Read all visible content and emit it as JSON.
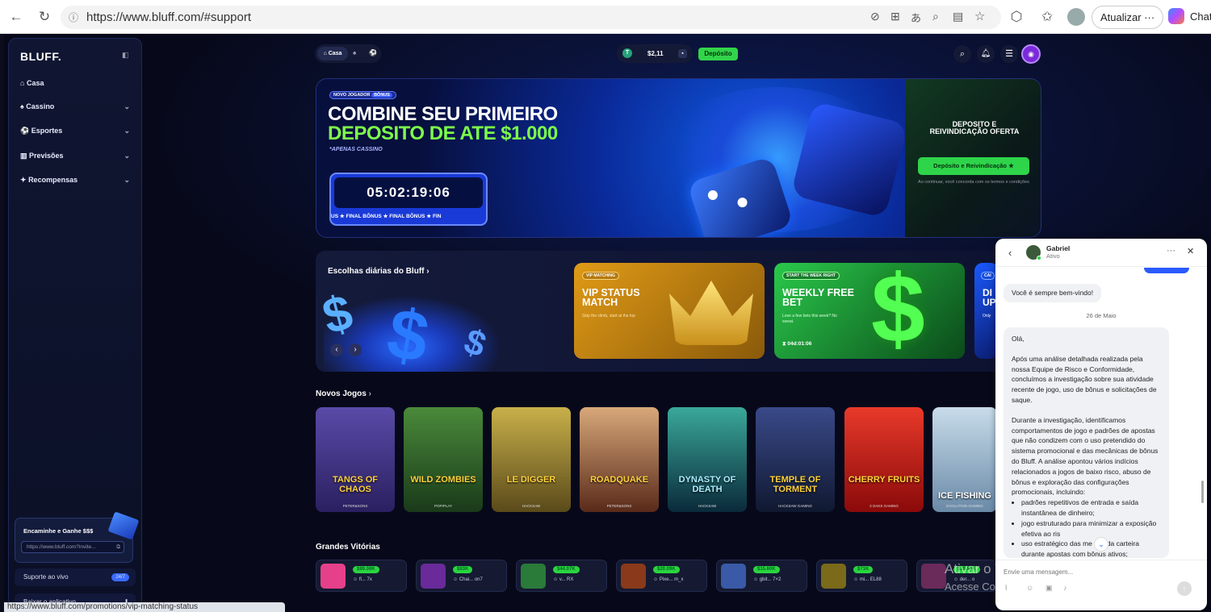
{
  "browser": {
    "url": "https://www.bluff.com/#support",
    "update_label": "Atualizar",
    "more": "···",
    "chat_label": "Chat",
    "status_url": "https://www.bluff.com/promotions/vip-matching-status"
  },
  "sidebar": {
    "logo": "BLUFF.",
    "items": [
      {
        "label": "Casa"
      },
      {
        "label": "Cassino"
      },
      {
        "label": "Esportes"
      },
      {
        "label": "Previsões"
      },
      {
        "label": "Recompensas"
      }
    ],
    "referral": {
      "title": "Encaminhe e Ganhe $$$",
      "link": "https://www.bluff.com?invite..."
    },
    "support": {
      "label": "Suporte ao vivo",
      "badge": "24/7"
    },
    "download": {
      "label": "Baixar o aplicativo"
    }
  },
  "topbar": {
    "home_tab": "Casa",
    "balance": "$2,11",
    "deposit": "Depósito"
  },
  "banner": {
    "tag1": "NOVO JOGADOR",
    "tag2": "BÔNUS",
    "headline1": "COMBINE SEU PRIMEIRO",
    "headline2": "DEPOSITO DE ATE $1.000",
    "sub": "*APENAS CASSINO",
    "timer": "05:02:19:06",
    "ticker": "US ★ FINAL BÔNUS ★ FINAL BÔNUS ★ FIN",
    "offer_title": "DEPOSITO E REIVINDICAÇÃO OFERTA",
    "offer_button": "Depósito e Reivindicação ★",
    "terms": "Ao continuar, você concorda com os termos e condições"
  },
  "daily": {
    "title": "Escolhas diárias do Bluff",
    "arrow": "›",
    "cards": [
      {
        "tag1": "VIP",
        "tag2": "MATCHING",
        "title": "VIP STATUS MATCH",
        "sub": "Skip the climb, start at the top",
        "color": "#c98a12"
      },
      {
        "tag1": "START THE",
        "tag2": "WEEK RIGHT",
        "title": "WEEKLY FREE BET",
        "sub": "Lose a few bets this week? No sweat.",
        "timer": "04d:01:06",
        "color": "#1b8a2c"
      },
      {
        "tag1": "CAI",
        "title": "DI UP",
        "sub": "Only",
        "color": "#1243b8"
      }
    ]
  },
  "new_games": {
    "title": "Novos Jogos",
    "games": [
      {
        "name": "TANGS OF CHAOS",
        "provider": "PETER&SONS",
        "color": "#4a3a8a"
      },
      {
        "name": "WILD ZOMBIES",
        "provider": "POPIPLAY",
        "color": "#3b6d2f"
      },
      {
        "name": "LE DIGGER",
        "provider": "HACKSAW",
        "color": "#8a7a2a"
      },
      {
        "name": "ROADQUAKE",
        "provider": "PETER&SONS",
        "color": "#8a4a2a"
      },
      {
        "name": "DYNASTY OF DEATH",
        "provider": "HACKSAW",
        "color": "#1f6a6a"
      },
      {
        "name": "TEMPLE OF TORMENT",
        "provider": "HACKSAW GAMING",
        "color": "#2a3a6a"
      },
      {
        "name": "CHERRY FRUITS",
        "provider": "3 OAKS GAMING",
        "color": "#c81e1e"
      },
      {
        "name": "ICE FISHING",
        "provider": "EVOLUTION GAMING",
        "color": "#8ab6d8"
      }
    ]
  },
  "big_wins": {
    "title": "Grandes Vitórias",
    "items": [
      {
        "amount": "$89.08K",
        "player": "fl... 7x",
        "color": "#e6408a"
      },
      {
        "amount": "$83K",
        "player": "Chai... on7",
        "color": "#6a2a9a"
      },
      {
        "amount": "$44.07K",
        "player": "v... RX",
        "color": "#2a7a3a"
      },
      {
        "amount": "$20.09K",
        "player": "Pixe... m_x",
        "color": "#8a3a1a"
      },
      {
        "amount": "$15.60K",
        "player": "gbit... 7×2",
        "color": "#3a5aa8"
      },
      {
        "amount": "$71K",
        "player": "mi... EL88",
        "color": "#7a6a1a"
      },
      {
        "amount": "$29.93K",
        "player": "der... o",
        "color": "#6a2a5a"
      }
    ]
  },
  "chat": {
    "agent": "Gabriel",
    "status": "Ativo",
    "welcome": "Você é sempre bem-vindo!",
    "date": "26 de Maio",
    "msg_greeting": "Olá,",
    "msg_p1": "Após uma análise detalhada realizada pela nossa Equipe de Risco e Conformidade, concluímos a investigação sobre sua atividade recente de jogo, uso de bônus e solicitações de saque.",
    "msg_p2": "Durante a investigação, identificamos comportamentos de jogo e padrões de apostas que não condizem com o uso pretendido do sistema promocional e das mecânicas de bônus do Bluff. A análise apontou vários indícios relacionados a jogos de baixo risco, abuso de bônus e exploração das configurações promocionais, incluindo:",
    "msg_b1": "padrões repetitivos de entrada e saída instantânea de dinheiro;",
    "msg_b2": "jogo estruturado para minimizar a exposição efetiva ao ris",
    "msg_b3": "uso estratégico das me      cas da carteira durante apostas com bônus ativos;",
    "input_placeholder": "Envie uma mensagem..."
  },
  "watermark": {
    "line1": "Ativar o Windows",
    "line2": "Acesse Configurações para ativar o Windows."
  }
}
